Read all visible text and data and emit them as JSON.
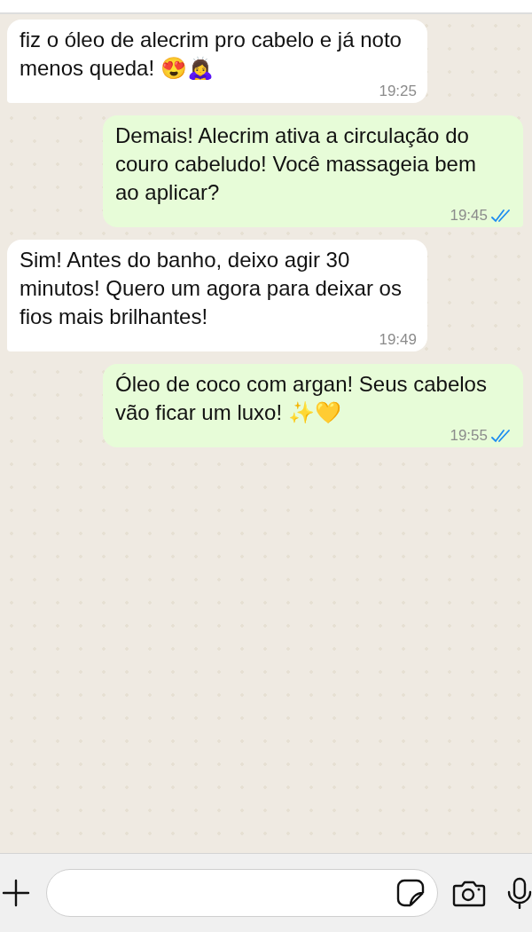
{
  "messages": [
    {
      "kind": "incoming",
      "text": "fiz o óleo de alecrim pro cabelo e já noto menos queda! 😍🙇‍♀️",
      "time": "19:25"
    },
    {
      "kind": "outgoing",
      "text": "Demais! Alecrim ativa a circulação do couro cabeludo! Você massageia bem ao aplicar?",
      "time": "19:45",
      "read": true
    },
    {
      "kind": "incoming",
      "text": "Sim! Antes do banho, deixo agir 30 minutos! Quero um agora para deixar os fios mais brilhantes!",
      "time": "19:49"
    },
    {
      "kind": "outgoing",
      "text": "Óleo de coco com argan! Seus cabelos vão ficar um luxo! ✨💛",
      "time": "19:55",
      "read": true
    }
  ]
}
